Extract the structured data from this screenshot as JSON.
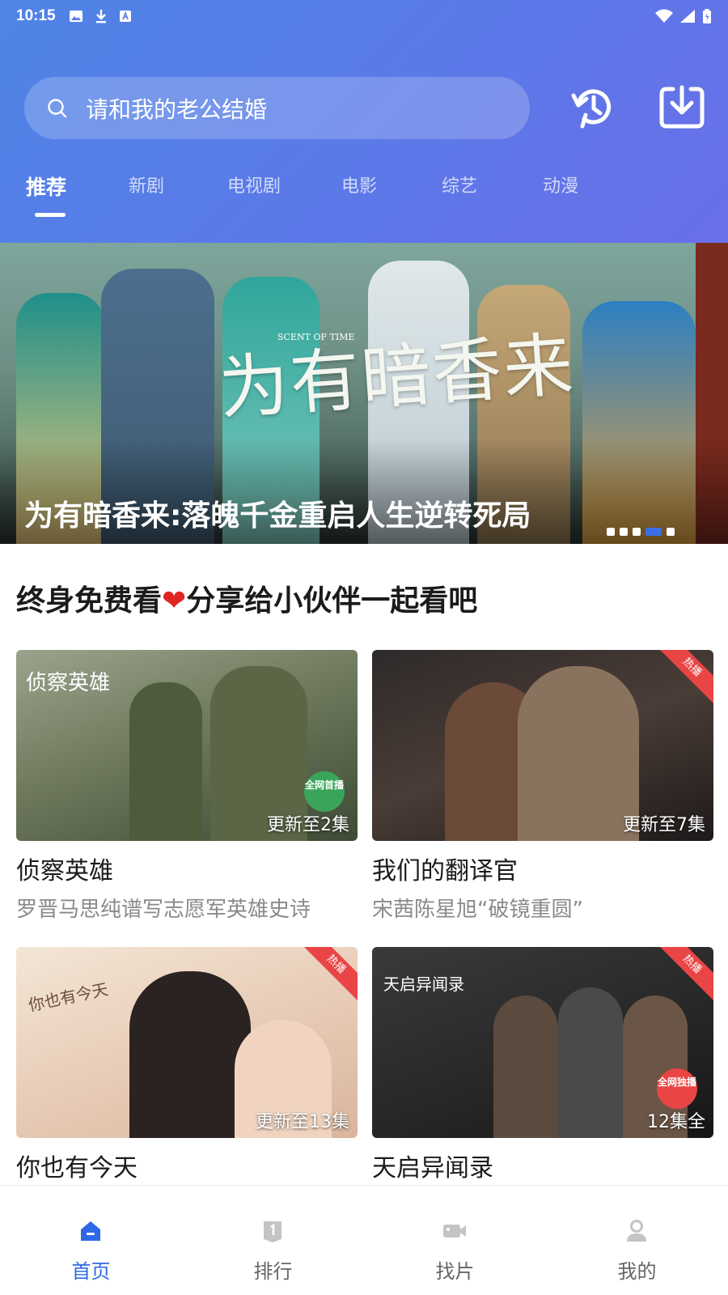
{
  "status_bar": {
    "time": "10:15"
  },
  "search": {
    "placeholder": "请和我的老公结婚"
  },
  "header_icons": {
    "history": "history-icon",
    "download": "download-icon"
  },
  "tabs": [
    {
      "label": "推荐",
      "active": true
    },
    {
      "label": "新剧"
    },
    {
      "label": "电视剧"
    },
    {
      "label": "电影"
    },
    {
      "label": "综艺"
    },
    {
      "label": "动漫"
    }
  ],
  "banner": {
    "art_title": "为有暗香来",
    "art_subtitle": "SCENT OF TIME",
    "caption": "为有暗香来:落魄千金重启人生逆转死局",
    "total_slides": 5,
    "active_slide": 4
  },
  "section": {
    "title_before": "终身免费看",
    "heart": "❤",
    "title_after": "分享给小伙伴一起看吧"
  },
  "cards": [
    {
      "title": "侦察英雄",
      "subtitle": "罗晋马思纯谱写志愿军英雄史诗",
      "label": "更新至2集",
      "badge": "全网首播",
      "hot": false,
      "thumb_text": "侦察英雄"
    },
    {
      "title": "我们的翻译官",
      "subtitle": "宋茜陈星旭“破镜重圆”",
      "label": "更新至7集",
      "hot": true,
      "hot_text": "热播"
    },
    {
      "title": "你也有今天",
      "subtitle": "",
      "label": "更新至13集",
      "hot": true,
      "hot_text": "热播",
      "thumb_text": "你也有今天"
    },
    {
      "title": "天启异闻录",
      "subtitle": "",
      "label": "12集全",
      "badge": "全网独播",
      "hot": true,
      "hot_text": "热播",
      "thumb_text": "天启异闻录"
    }
  ],
  "bottom_nav": [
    {
      "label": "首页",
      "icon": "home-icon",
      "active": true
    },
    {
      "label": "排行",
      "icon": "ranking-icon"
    },
    {
      "label": "找片",
      "icon": "video-camera-icon"
    },
    {
      "label": "我的",
      "icon": "profile-icon"
    }
  ],
  "colors": {
    "header_start": "#4f84e6",
    "header_end": "#6a6fe9",
    "accent": "#2f68e6",
    "hot": "#e94545",
    "badge_green": "#3aa55a"
  }
}
